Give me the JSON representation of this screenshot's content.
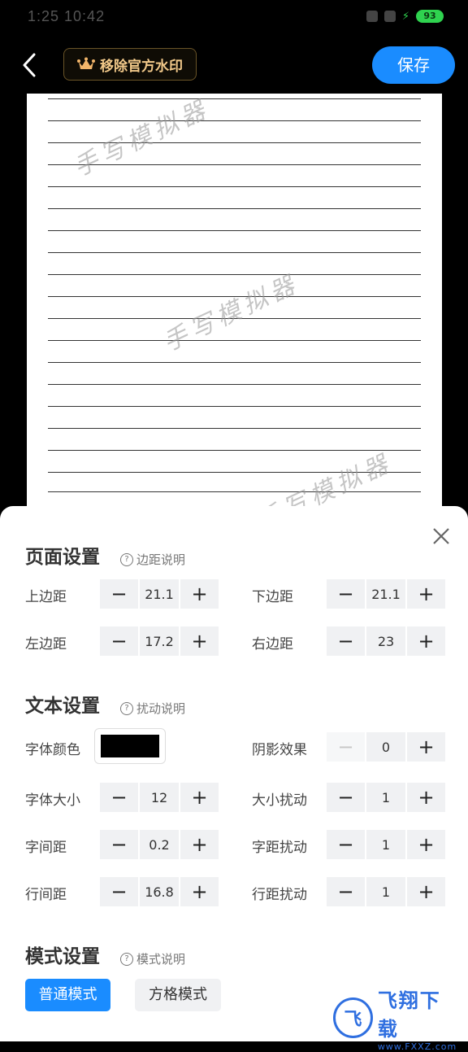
{
  "status_bar": {
    "time": "1:25 10:42",
    "battery": "93"
  },
  "header": {
    "watermark_button": "移除官方水印",
    "save_button": "保存"
  },
  "paper": {
    "watermark": "手写模拟器"
  },
  "page_settings": {
    "title": "页面设置",
    "help": "边距说明",
    "top_margin": {
      "label": "上边距",
      "value": "21.1"
    },
    "bottom_margin": {
      "label": "下边距",
      "value": "21.1"
    },
    "left_margin": {
      "label": "左边距",
      "value": "17.2"
    },
    "right_margin": {
      "label": "右边距",
      "value": "23"
    }
  },
  "text_settings": {
    "title": "文本设置",
    "help": "扰动说明",
    "font_color": {
      "label": "字体颜色",
      "color": "#000000"
    },
    "shadow": {
      "label": "阴影效果",
      "value": "0"
    },
    "font_size": {
      "label": "字体大小",
      "value": "12"
    },
    "size_jitter": {
      "label": "大小扰动",
      "value": "1"
    },
    "char_spacing": {
      "label": "字间距",
      "value": "0.2"
    },
    "char_jitter": {
      "label": "字距扰动",
      "value": "1"
    },
    "line_spacing": {
      "label": "行间距",
      "value": "16.8"
    },
    "line_jitter": {
      "label": "行距扰动",
      "value": "1"
    }
  },
  "mode_settings": {
    "title": "模式设置",
    "help": "模式说明",
    "normal_mode": "普通模式",
    "grid_mode": "方格模式"
  },
  "watermark_logo": {
    "cn": "飞翔下载",
    "url": "www.FXXZ.com"
  },
  "colors": {
    "accent": "#1a8cff",
    "gold": "#f2c98a",
    "battery": "#2fd34f"
  }
}
